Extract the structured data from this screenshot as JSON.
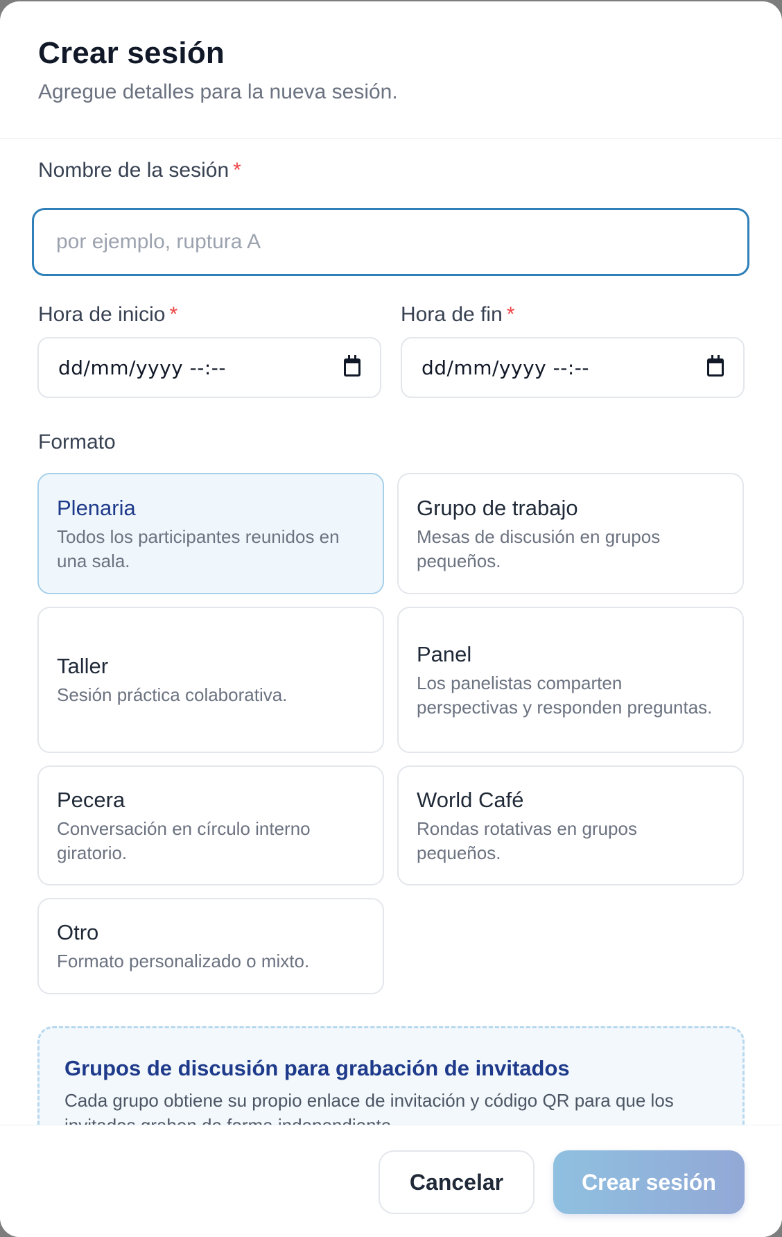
{
  "header": {
    "title": "Crear sesión",
    "subtitle": "Agregue detalles para la nueva sesión."
  },
  "form": {
    "name_label": "Nombre de la sesión",
    "name_placeholder": "por ejemplo, ruptura A",
    "name_value": "",
    "required_mark": "*",
    "start_label": "Hora de inicio",
    "start_value": "dd/mm/yyyy --:--",
    "end_label": "Hora de fin",
    "end_value": "dd/mm/yyyy --:--",
    "format_label": "Formato"
  },
  "formats": [
    {
      "title": "Plenaria",
      "desc": "Todos los participantes reunidos en una sala.",
      "selected": true
    },
    {
      "title": "Grupo de trabajo",
      "desc": "Mesas de discusión en grupos pequeños.",
      "selected": false
    },
    {
      "title": "Taller",
      "desc": "Sesión práctica colaborativa.",
      "selected": false
    },
    {
      "title": "Panel",
      "desc": "Los panelistas comparten perspectivas y responden preguntas.",
      "selected": false
    },
    {
      "title": "Pecera",
      "desc": "Conversación en círculo interno giratorio.",
      "selected": false
    },
    {
      "title": "World Café",
      "desc": "Rondas rotativas en grupos pequeños.",
      "selected": false
    },
    {
      "title": "Otro",
      "desc": "Formato personalizado o mixto.",
      "selected": false
    }
  ],
  "info": {
    "title": "Grupos de discusión para grabación de invitados",
    "desc": "Cada grupo obtiene su propio enlace de invitación y código QR para que los invitados graben de forma independiente."
  },
  "footer": {
    "cancel_label": "Cancelar",
    "create_label": "Crear sesión"
  },
  "colors": {
    "accent": "#2f7fb8",
    "required": "#ef4444",
    "selected_bg": "#f0f7fc"
  }
}
